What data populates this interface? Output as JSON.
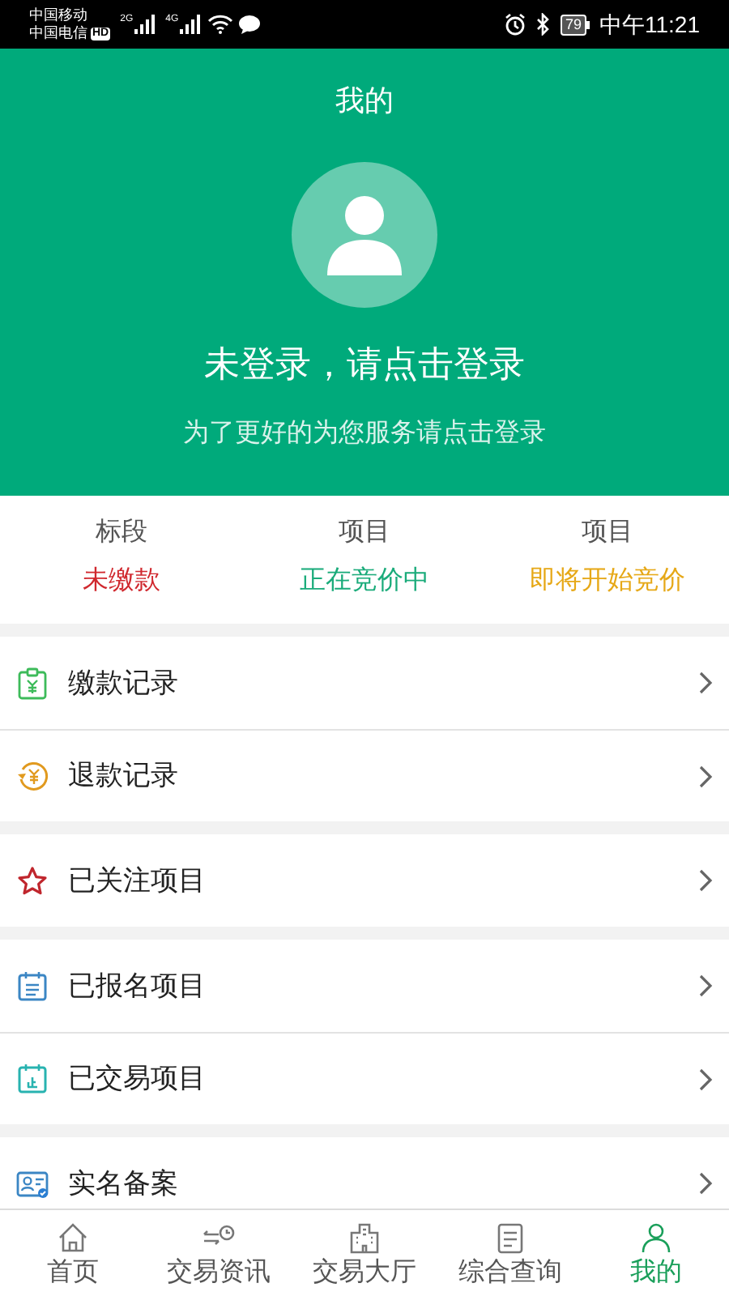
{
  "status_bar": {
    "carriers": [
      "中国移动",
      "中国电信"
    ],
    "hd": "HD",
    "network_labels": [
      "2G",
      "4G"
    ],
    "battery": "79",
    "time": "中午11:21"
  },
  "header": {
    "title": "我的",
    "login_prompt": "未登录，请点击登录",
    "subtitle": "为了更好的为您服务请点击登录"
  },
  "stats": [
    {
      "label": "标段",
      "value": "未缴款",
      "color": "#d0282e"
    },
    {
      "label": "项目",
      "value": "正在竞价中",
      "color": "#1aab7a"
    },
    {
      "label": "项目",
      "value": "即将开始竞价",
      "color": "#e6a817"
    }
  ],
  "menu_groups": [
    {
      "items": [
        {
          "label": "缴款记录"
        },
        {
          "label": "退款记录"
        }
      ]
    },
    {
      "items": [
        {
          "label": "已关注项目"
        }
      ]
    },
    {
      "items": [
        {
          "label": "已报名项目"
        },
        {
          "label": "已交易项目"
        }
      ]
    },
    {
      "items": [
        {
          "label": "实名备案"
        }
      ]
    }
  ],
  "bottom_nav": [
    {
      "label": "首页",
      "selected": false
    },
    {
      "label": "交易资讯",
      "selected": false
    },
    {
      "label": "交易大厅",
      "selected": false
    },
    {
      "label": "综合查询",
      "selected": false
    },
    {
      "label": "我的",
      "selected": true
    }
  ]
}
